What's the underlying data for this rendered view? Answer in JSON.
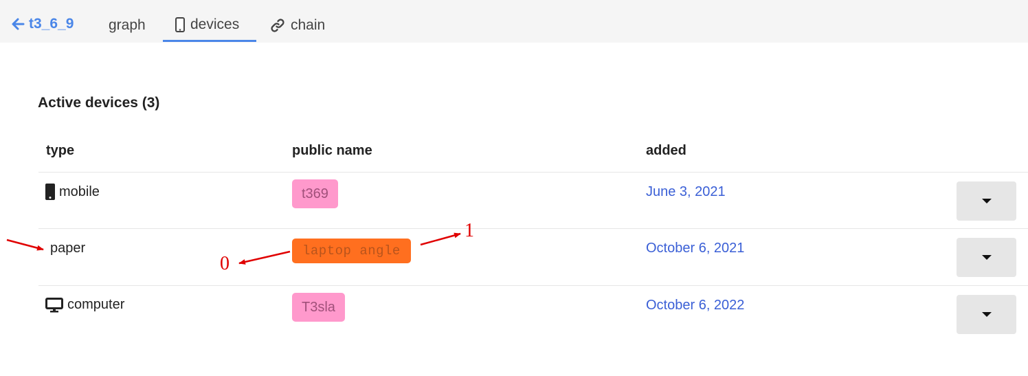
{
  "nav": {
    "back_label": "t3_6_9",
    "tabs": [
      {
        "label": "graph",
        "icon": "none"
      },
      {
        "label": "devices",
        "icon": "mobile-phone-icon",
        "active": true
      },
      {
        "label": "chain",
        "icon": "link-icon"
      }
    ]
  },
  "section": {
    "title": "Active devices (3)"
  },
  "table": {
    "headers": [
      "type",
      "public name",
      "added"
    ],
    "rows": [
      {
        "type": "mobile",
        "type_icon": "mobile-phone-icon",
        "public_name": "t369",
        "tag_color": "#ff99cc",
        "added": "June 3, 2021"
      },
      {
        "type": "paper",
        "type_icon": "none",
        "public_name": "laptop angle",
        "tag_color": "#ff6f1f",
        "added": "October 6, 2021"
      },
      {
        "type": "computer",
        "type_icon": "desktop-monitor-icon",
        "public_name": "T3sla",
        "tag_color": "#ff99cc",
        "added": "October 6, 2022"
      }
    ]
  },
  "annotations": {
    "label_0": "0",
    "label_1": "1",
    "color": "#e00000"
  },
  "colors": {
    "accent": "#4a86e8",
    "date_link": "#3a5fd6",
    "topbar_bg": "#f5f5f5",
    "button_bg": "#e6e6e6"
  }
}
